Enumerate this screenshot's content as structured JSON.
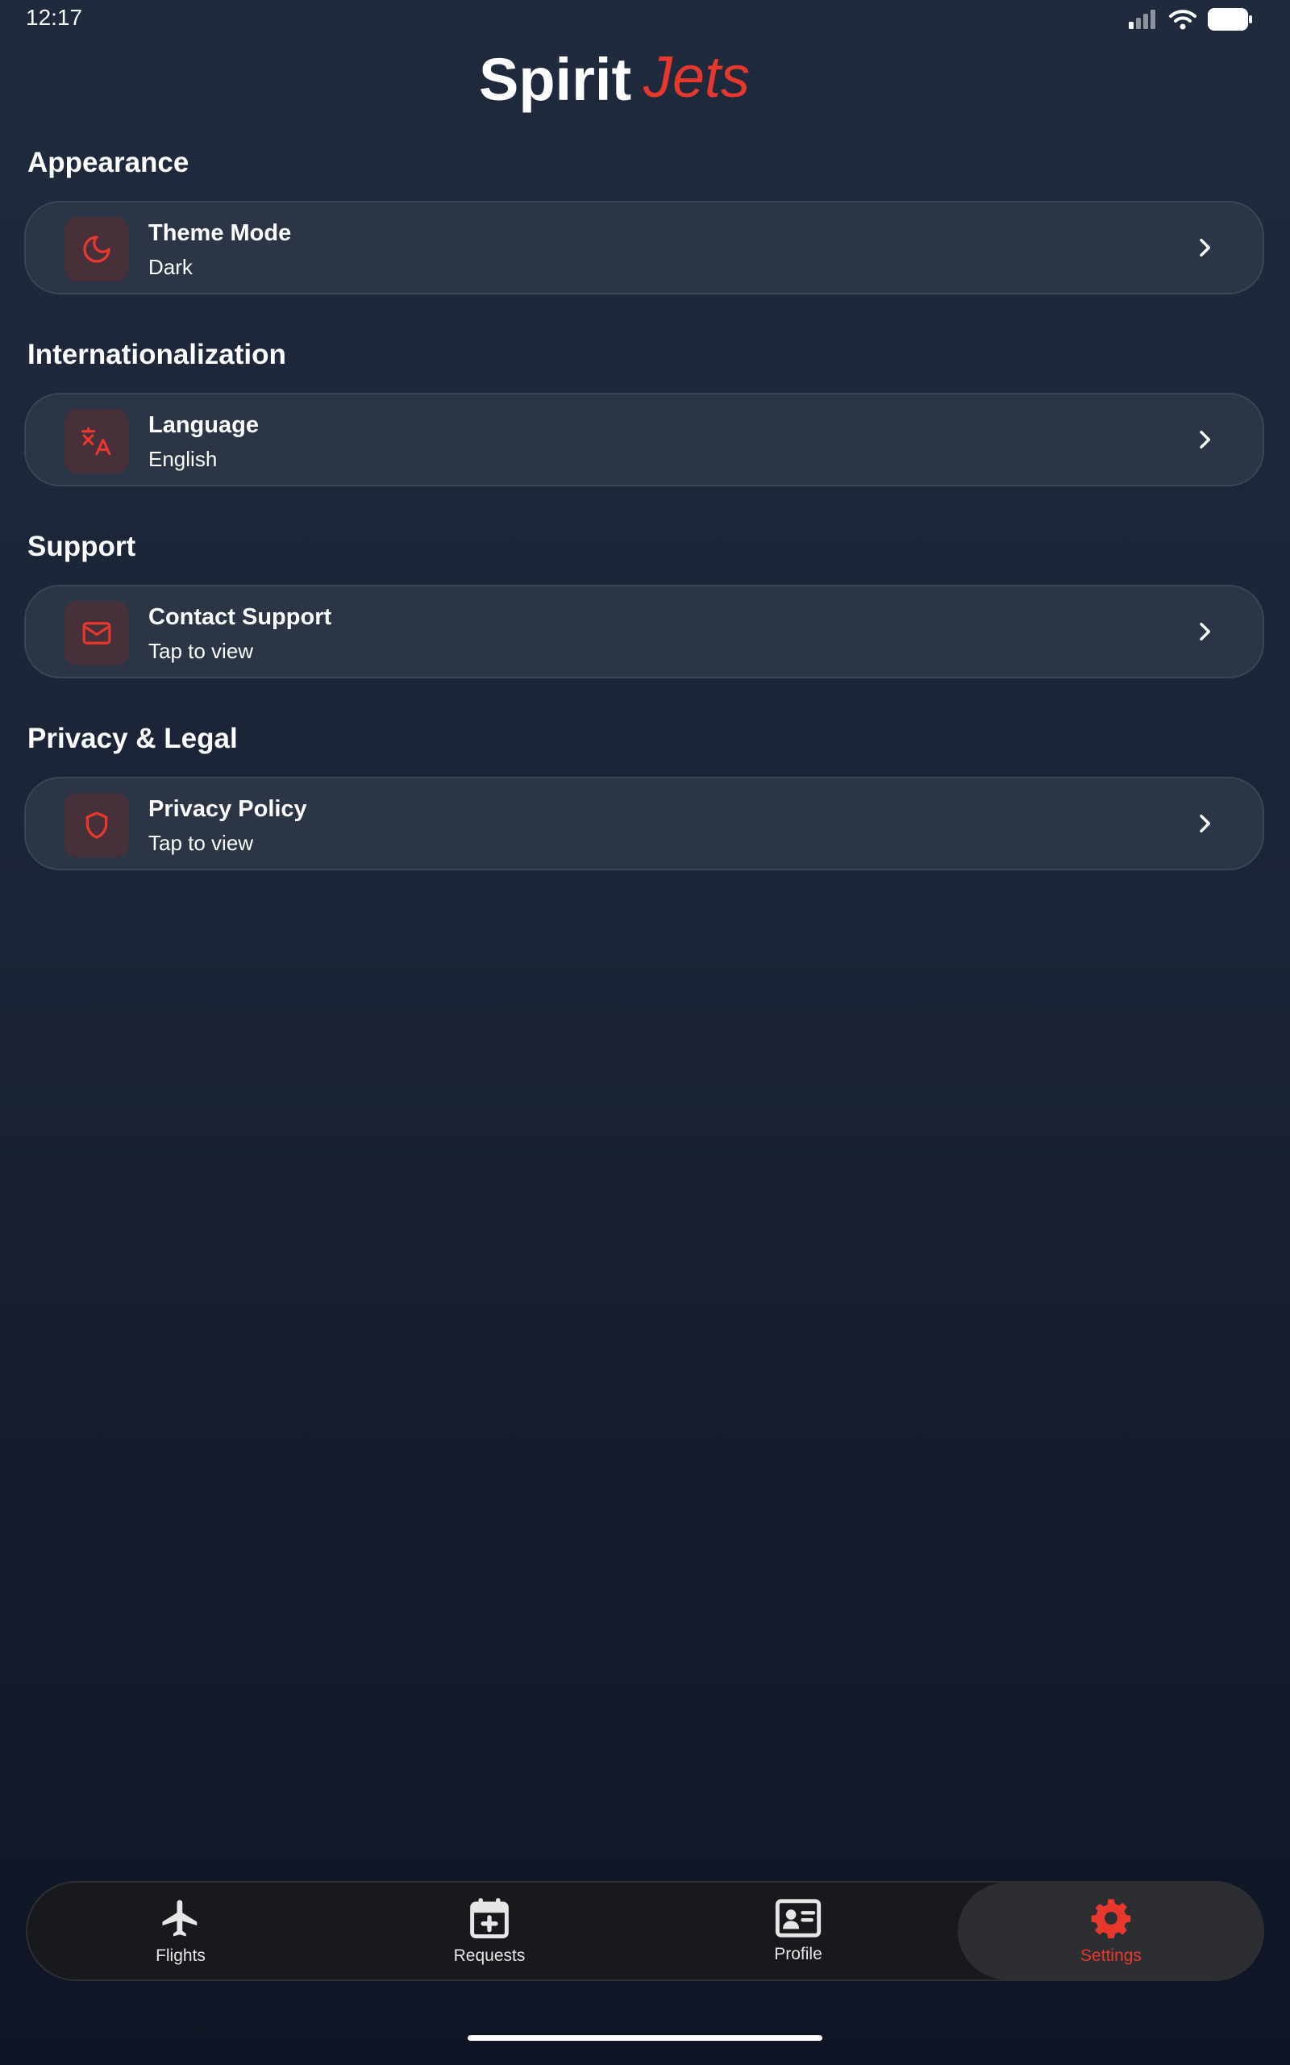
{
  "status_bar": {
    "time": "12:17"
  },
  "brand": {
    "logo_part1": "Spirit",
    "logo_part2": "Jets",
    "accent_color": "#e8382d"
  },
  "sections": [
    {
      "title": "Appearance",
      "item": {
        "icon": "moon-icon",
        "title": "Theme Mode",
        "subtitle": "Dark"
      }
    },
    {
      "title": "Internationalization",
      "item": {
        "icon": "translate-icon",
        "title": "Language",
        "subtitle": "English"
      }
    },
    {
      "title": "Support",
      "item": {
        "icon": "mail-icon",
        "title": "Contact Support",
        "subtitle": "Tap to view"
      }
    },
    {
      "title": "Privacy & Legal",
      "item": {
        "icon": "shield-icon",
        "title": "Privacy Policy",
        "subtitle": "Tap to view"
      }
    }
  ],
  "nav": {
    "items": [
      {
        "label": "Flights",
        "icon": "airplane-icon"
      },
      {
        "label": "Requests",
        "icon": "calendar-plus-icon"
      },
      {
        "label": "Profile",
        "icon": "id-card-icon"
      },
      {
        "label": "Settings",
        "icon": "gear-icon"
      }
    ],
    "active": "Settings"
  }
}
